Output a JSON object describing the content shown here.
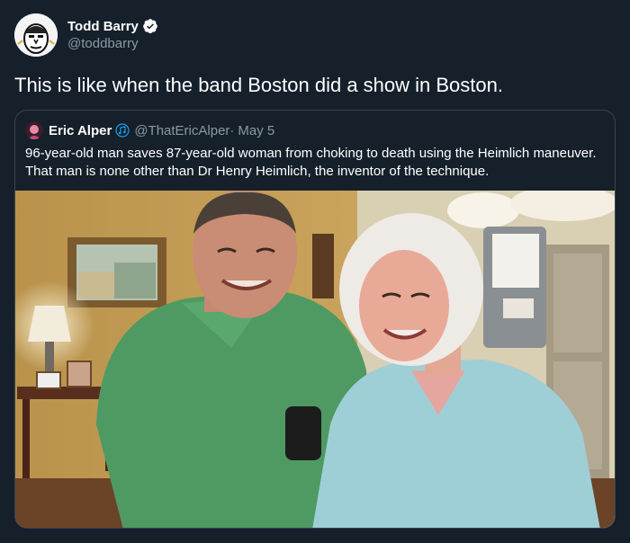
{
  "tweet": {
    "author": {
      "name": "Todd Barry",
      "handle": "@toddbarry",
      "avatar_icon": "caricature-avatar",
      "verified_icon": "verified-badge-icon"
    },
    "text": "This is like when the band Boston did a show in Boston."
  },
  "quoted_tweet": {
    "author": {
      "name": "Eric Alper",
      "name_icon": "music-note-icon",
      "handle": "@ThatEricAlper",
      "separator": "·",
      "date": "May 5"
    },
    "text_lines": [
      "96-year-old man saves 87-year-old woman from choking to death using the Heimlich maneuver.",
      "That man is none other than Dr Henry Heimlich, the inventor of the technique."
    ]
  },
  "colors": {
    "background": "#15202b",
    "border": "#38444d",
    "secondary_text": "#8b98a5",
    "verified": "#1d9bf0"
  }
}
